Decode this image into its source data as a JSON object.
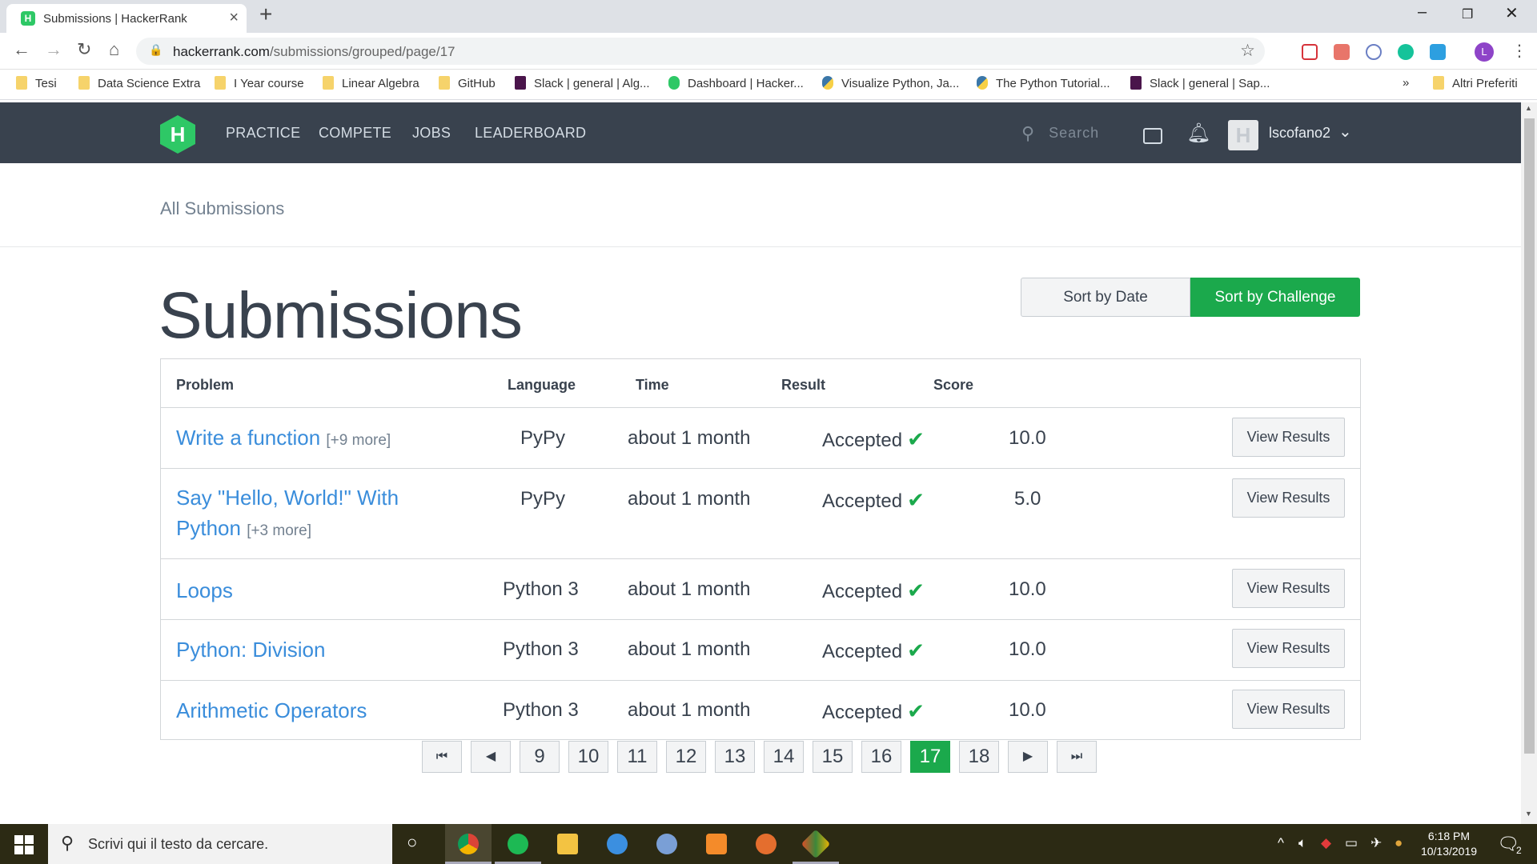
{
  "browser": {
    "tab_title": "Submissions | HackerRank",
    "url_host": "hackerrank.com",
    "url_path": "/submissions/grouped/page/17",
    "bookmarks": [
      "Tesi",
      "Data Science Extra",
      "I Year course",
      "Linear Algebra",
      "GitHub",
      "Slack | general | Alg...",
      "Dashboard | Hacker...",
      "Visualize Python, Ja...",
      "The Python Tutorial...",
      "Slack | general | Sap..."
    ],
    "bookmarks_overflow": "»",
    "other_bookmarks": "Altri Preferiti",
    "profile_initial": "L"
  },
  "hr_nav": {
    "links": [
      "PRACTICE",
      "COMPETE",
      "JOBS",
      "LEADERBOARD"
    ],
    "search_placeholder": "Search",
    "username": "lscofano2"
  },
  "page": {
    "breadcrumb": "All Submissions",
    "title": "Submissions",
    "sort_by_date": "Sort by Date",
    "sort_by_challenge": "Sort by Challenge"
  },
  "table": {
    "headers": [
      "Problem",
      "Language",
      "Time",
      "Result",
      "Score"
    ],
    "view_label": "View Results",
    "rows": [
      {
        "problem": "Write a function",
        "more": "[+9 more]",
        "language": "PyPy",
        "time": "about 1 month",
        "result": "Accepted",
        "score": "10.0"
      },
      {
        "problem": "Say \"Hello, World!\" With Python",
        "more": "[+3 more]",
        "language": "PyPy",
        "time": "about 1 month",
        "result": "Accepted",
        "score": "5.0"
      },
      {
        "problem": "Loops",
        "more": "",
        "language": "Python 3",
        "time": "about 1 month",
        "result": "Accepted",
        "score": "10.0"
      },
      {
        "problem": "Python: Division",
        "more": "",
        "language": "Python 3",
        "time": "about 1 month",
        "result": "Accepted",
        "score": "10.0"
      },
      {
        "problem": "Arithmetic Operators",
        "more": "",
        "language": "Python 3",
        "time": "about 1 month",
        "result": "Accepted",
        "score": "10.0"
      }
    ]
  },
  "pagination": {
    "pages": [
      "9",
      "10",
      "11",
      "12",
      "13",
      "14",
      "15",
      "16",
      "17",
      "18"
    ],
    "current": "17"
  },
  "taskbar": {
    "search_placeholder": "Scrivi qui il testo da cercare.",
    "time": "6:18 PM",
    "date": "10/13/2019",
    "notification_count": "2"
  },
  "colors": {
    "brand_green": "#1ba94c",
    "nav_bg": "#39424e",
    "link_blue": "#3a8ddb"
  }
}
